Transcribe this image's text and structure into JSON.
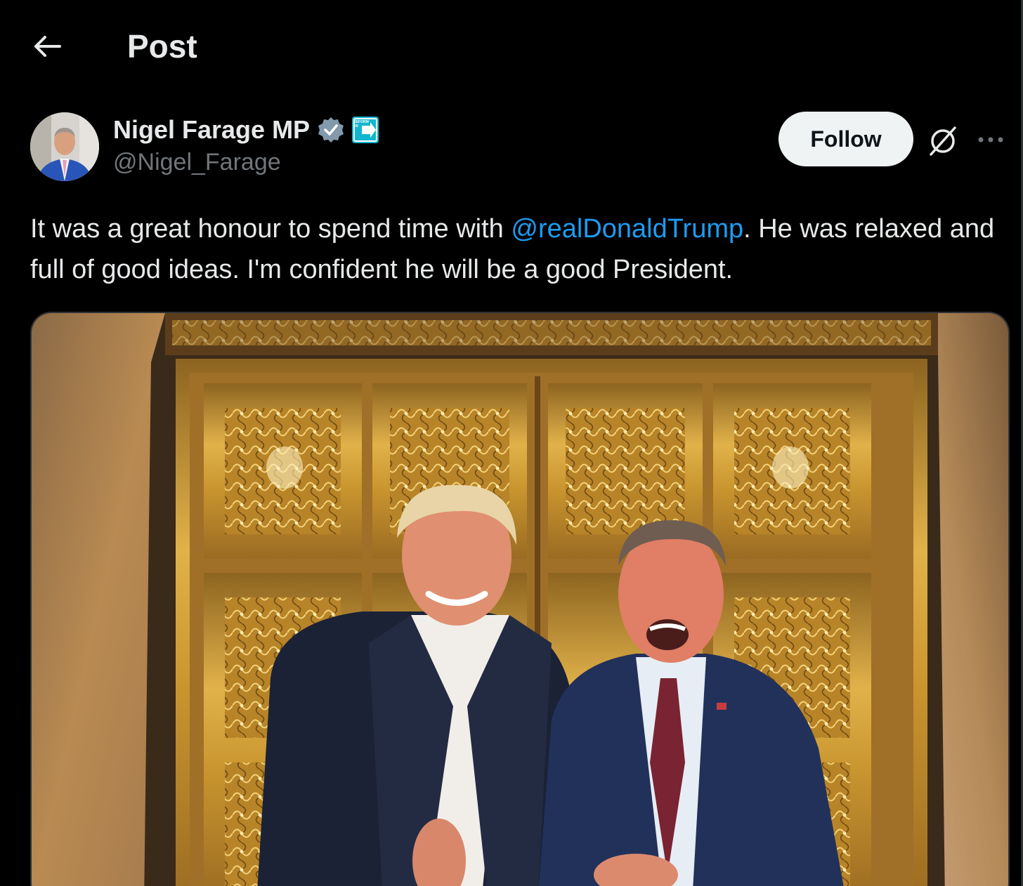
{
  "header": {
    "back_icon": "arrow-left-icon",
    "title": "Post"
  },
  "author": {
    "display_name": "Nigel Farage MP",
    "verified_icon": "verified-badge-icon",
    "affiliate_badge": "reform-uk-badge",
    "affiliate_badge_text": "REFORM UK",
    "handle": "@Nigel_Farage",
    "follow_label": "Follow",
    "grok_icon": "grok-icon",
    "more_icon": "more-horizontal-icon"
  },
  "tweet": {
    "text_before": "It was a great honour to spend time with ",
    "mention": "@realDonaldTrump",
    "text_after": ". He was relaxed and full of good ideas. I'm confident he will be a good President."
  },
  "media": {
    "description_icon": "photo-image",
    "colors": {
      "gold": "#c9952f",
      "marble": "#b98a52",
      "suit_dark": "#1b2236",
      "suit_navy": "#22315a"
    }
  },
  "colors": {
    "background": "#000000",
    "text_primary": "#e7e9ea",
    "text_secondary": "#71767b",
    "link": "#1d9bf0",
    "verified": "#829aab",
    "follow_bg": "#eff3f4"
  }
}
